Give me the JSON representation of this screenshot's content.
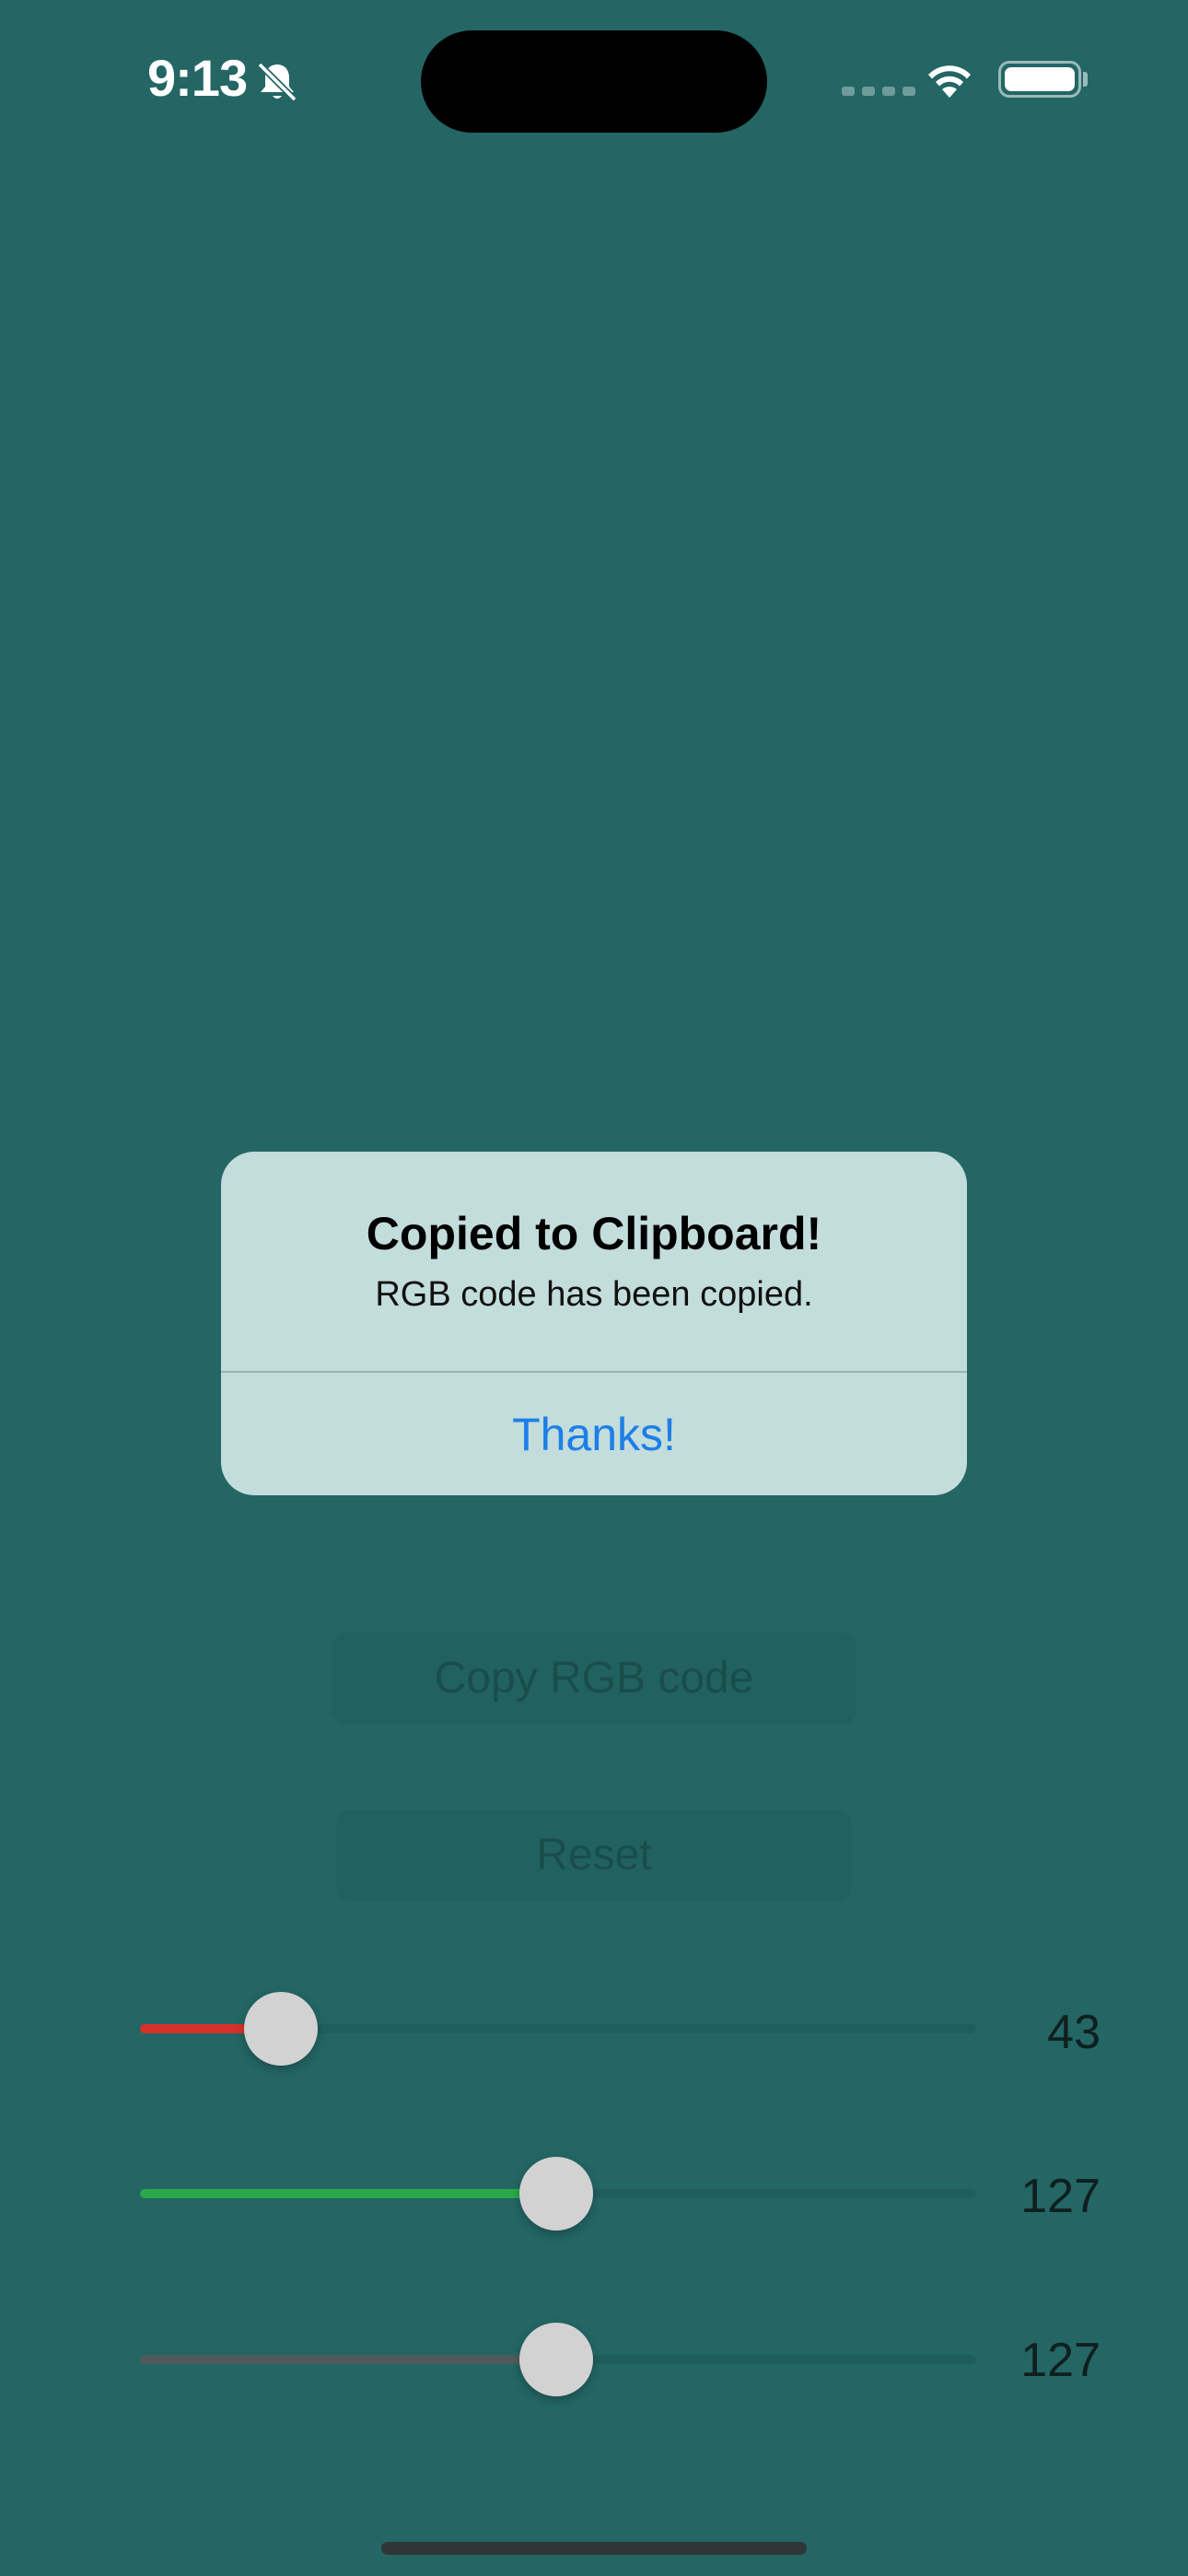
{
  "status_bar": {
    "time": "9:13",
    "icons": [
      "bell-slash-icon",
      "cellular-signal-icon",
      "wifi-icon",
      "battery-icon"
    ]
  },
  "background": {
    "color": "#236664"
  },
  "buttons": {
    "copy_label": "Copy RGB code",
    "reset_label": "Reset"
  },
  "sliders": [
    {
      "name": "red",
      "value": "43",
      "fraction": 0.169,
      "color": "#d8312c"
    },
    {
      "name": "green",
      "value": "127",
      "fraction": 0.498,
      "color": "#2aa84a"
    },
    {
      "name": "blue",
      "value": "127",
      "fraction": 0.498,
      "color": "#505a5a"
    }
  ],
  "alert": {
    "title": "Copied to Clipboard!",
    "message": "RGB code has been copied.",
    "button_label": "Thanks!",
    "button_color": "#1d7fe6"
  }
}
